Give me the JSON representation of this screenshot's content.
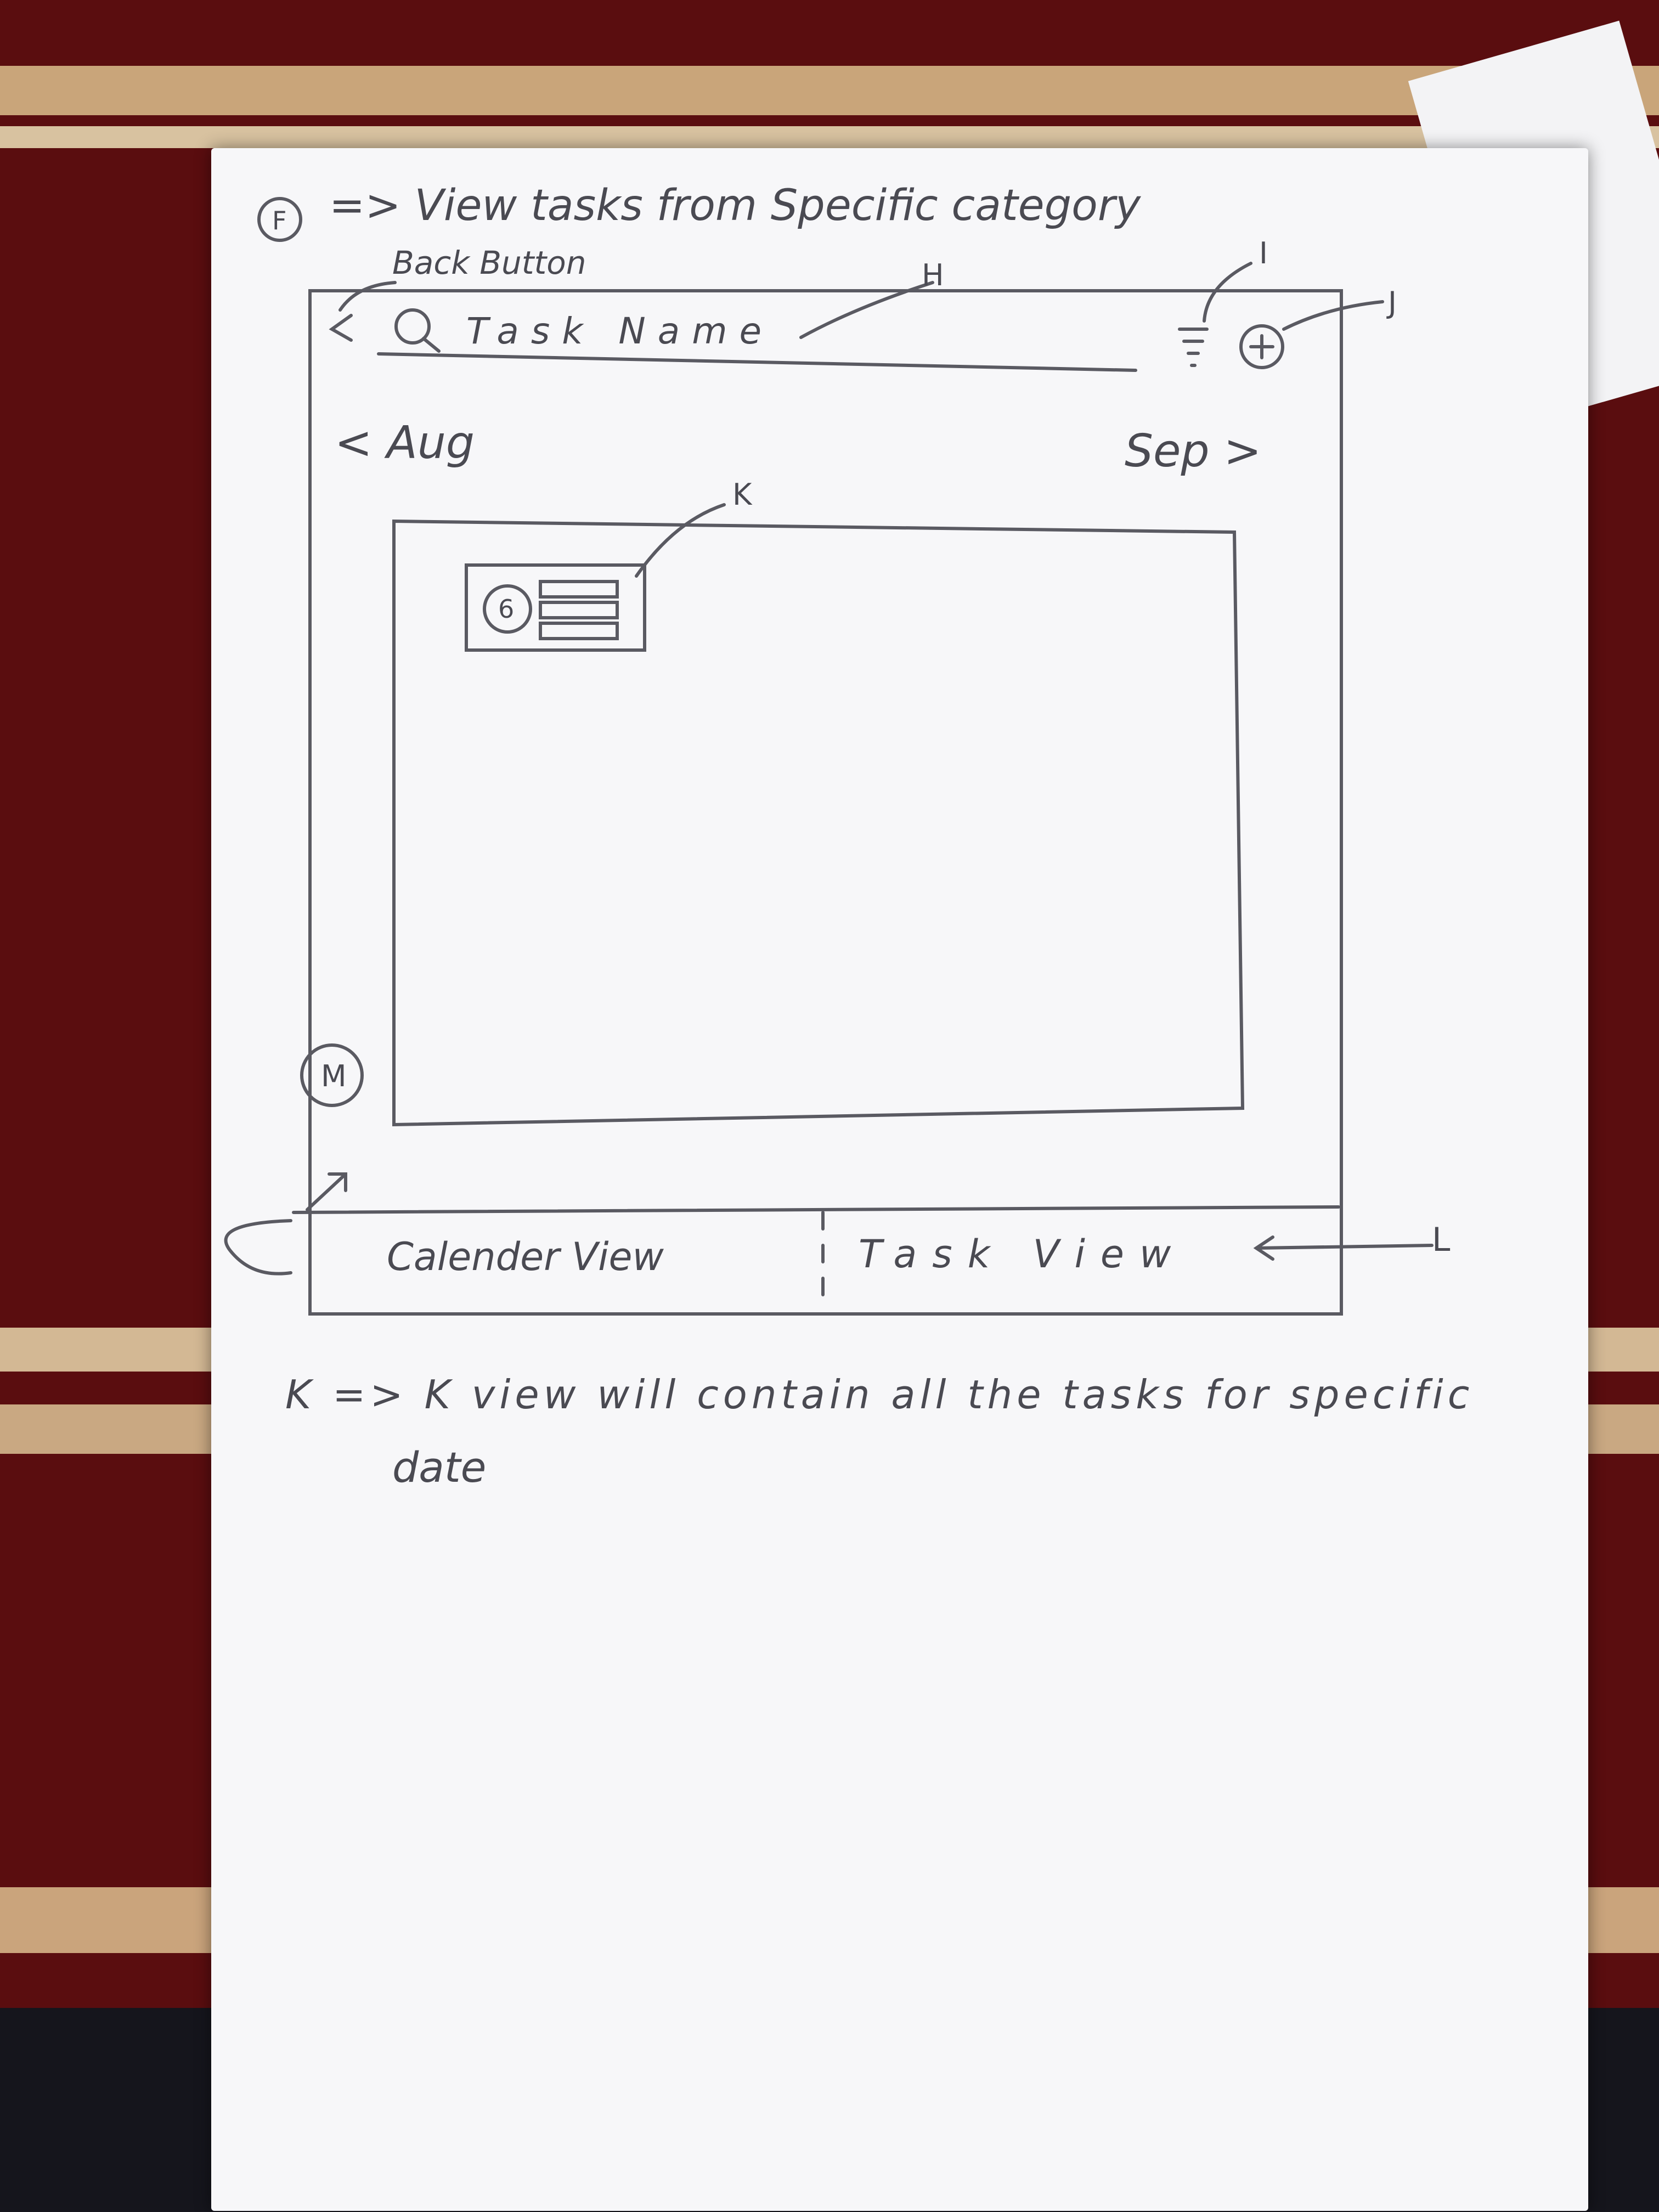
{
  "page": {
    "heading_marker": "F",
    "heading_text": "=> View tasks from Specific category"
  },
  "annotations": {
    "back_button": "Back Button",
    "h": "H",
    "i": "I",
    "j": "J",
    "k": "K",
    "l": "L"
  },
  "header": {
    "back_icon": "chevron-left-icon",
    "search_placeholder": "Task Name",
    "filter_icon": "filter-icon",
    "add_icon": "plus-circle-icon"
  },
  "month_nav": {
    "prev_label": "< Aug",
    "next_label": "Sep >"
  },
  "task_card": {
    "count": "6"
  },
  "fab": {
    "label": "M"
  },
  "bottom_tabs": [
    {
      "label": "Calender View"
    },
    {
      "label": "Task View"
    }
  ],
  "footnote": {
    "line1": "K => K view will contain all the tasks for specific",
    "line2": "date"
  },
  "colors": {
    "background": "#5a0d0f",
    "paper": "#f7f7f9",
    "pencil": "#4a4a52"
  }
}
